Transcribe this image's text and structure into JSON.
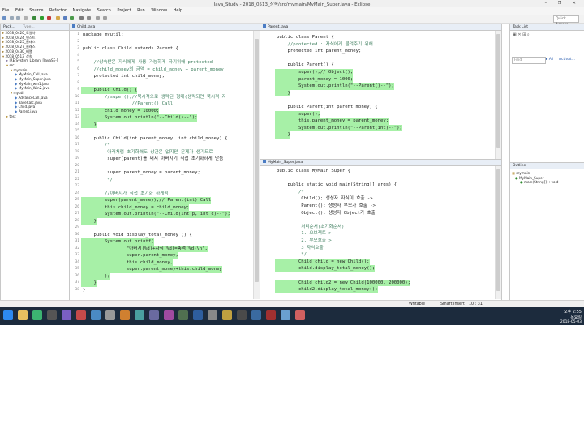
{
  "window": {
    "title": "Java_Study - 2018_0513_상속/src/mymain/MyMain_Super.java - Eclipse",
    "buttons": "– ❐ ✕"
  },
  "menu": [
    "File",
    "Edit",
    "Source",
    "Refactor",
    "Navigate",
    "Search",
    "Project",
    "Run",
    "Window",
    "Help"
  ],
  "quick_access": "Quick Access",
  "package_explorer": {
    "tab": "Pack...",
    "tab2": "Type...",
    "items": [
      "2018_0420_도일차",
      "2018_0424_연스트",
      "2018_0425_클래스",
      "2018_0427_클래스",
      "2018_0430_배열",
      "2018_0513_상속",
      "JRE System Library [JavaSE-]",
      "src",
      "mymain",
      "MyMain_Call.java",
      "MyMain_Super.java",
      "MyMain_win1.java",
      "MyMain_Win2.java",
      "myutil",
      "AdvanceCall.java",
      "BaseCalc.java",
      "Child.java",
      "Parent.java",
      "test"
    ]
  },
  "child_editor": {
    "tab": "Child.java",
    "lines": [
      [
        "1",
        "package myutil;",
        ""
      ],
      [
        "2",
        "",
        ""
      ],
      [
        "3",
        "public class Child extends Parent {",
        ""
      ],
      [
        "4",
        "",
        ""
      ],
      [
        "5",
        "    //상속받은 자식에게 사용 가능하게 하기위해 protected",
        ""
      ],
      [
        "6",
        "    //child_money의 금액 = child_money + parent_money",
        ""
      ],
      [
        "7",
        "    protected int child_money;",
        ""
      ],
      [
        "8",
        "",
        ""
      ],
      [
        "9",
        "    public Child() {",
        "hl"
      ],
      [
        "10",
        "        //super();//묵시적으로 생략된 형태(생략되면 묵시적 자",
        ""
      ],
      [
        "11",
        "                  //Parent() Call",
        ""
      ],
      [
        "12",
        "        child_money = 10000;",
        "hl"
      ],
      [
        "13",
        "        System.out.println(\"--Child()--\");",
        "hl"
      ],
      [
        "14",
        "    }",
        "hl"
      ],
      [
        "15",
        "",
        ""
      ],
      [
        "16",
        "    public Child(int parent_money, int child_money) {",
        ""
      ],
      [
        "17",
        "        /*",
        ""
      ],
      [
        "18",
        "         아래처럼 초기화해도 상관은 없지만 문제가 생기므로",
        ""
      ],
      [
        "19",
        "         super(parent)를 써서 아버지기 직접 초기화하게 만듬",
        ""
      ],
      [
        "20",
        "",
        ""
      ],
      [
        "21",
        "         super.parent_money = parent_money;",
        ""
      ],
      [
        "22",
        "         */",
        ""
      ],
      [
        "23",
        "",
        ""
      ],
      [
        "24",
        "        //아버지가 직접 초기화 하게됨",
        ""
      ],
      [
        "25",
        "        super(parent_money);// Parent(int) Call",
        "hl"
      ],
      [
        "26",
        "        this.child_money = child_money;",
        "hl"
      ],
      [
        "27",
        "        System.out.println(\"--Child(int p, int c)--\");",
        "hl"
      ],
      [
        "28",
        "    }",
        "hl"
      ],
      [
        "29",
        "",
        ""
      ],
      [
        "30",
        "    public void display_total_money () {",
        ""
      ],
      [
        "31",
        "        System.out.printf(",
        "hl"
      ],
      [
        "32",
        "                \"아버지(%d)+자식(%d)=총액(%d)\\n\",",
        "hl"
      ],
      [
        "33",
        "                super.parent_money,",
        "hl"
      ],
      [
        "34",
        "                this.child_money,",
        "hl"
      ],
      [
        "35",
        "                super.parent_money+this.child_money",
        "hl"
      ],
      [
        "36",
        "        );",
        "hl"
      ],
      [
        "37",
        "    }",
        "hl"
      ],
      [
        "38",
        "}",
        ""
      ]
    ]
  },
  "parent_editor": {
    "tab": "Parent.java",
    "lines": [
      [
        "",
        "public class Parent {",
        ""
      ],
      [
        "",
        "    //protected : 자식에게 물려주기 위해",
        ""
      ],
      [
        "",
        "    protected int parent_money;",
        ""
      ],
      [
        "",
        "",
        ""
      ],
      [
        "",
        "    public Parent() {",
        ""
      ],
      [
        "",
        "        super();// Object();",
        "hl"
      ],
      [
        "",
        "        parent_money = 1000;",
        "hl"
      ],
      [
        "",
        "        System.out.println(\"--Parent()--\");",
        "hl"
      ],
      [
        "",
        "    }",
        "hl"
      ],
      [
        "",
        "",
        ""
      ],
      [
        "",
        "    public Parent(int parent_money) {",
        ""
      ],
      [
        "",
        "        super();",
        "hl"
      ],
      [
        "",
        "        this.parent_money = parent_money;",
        "hl"
      ],
      [
        "",
        "        System.out.println(\"--Parent(int)--\");",
        "hl"
      ],
      [
        "",
        "    }",
        "hl"
      ]
    ]
  },
  "super_editor": {
    "tab": "MyMain_Super.java",
    "lines": [
      [
        "",
        "public class MyMain_Super {",
        ""
      ],
      [
        "",
        "",
        ""
      ],
      [
        "",
        "    public static void main(String[] args) {",
        ""
      ],
      [
        "",
        "        /*",
        ""
      ],
      [
        "",
        "         Child(); 생성자 자식이 호출 ->",
        ""
      ],
      [
        "",
        "         Parent(); 생성자 부모가 호출 ->",
        ""
      ],
      [
        "",
        "         Object(); 생성자 Object가 호출",
        ""
      ],
      [
        "",
        "",
        ""
      ],
      [
        "",
        "         처리순서(초기화순서)",
        ""
      ],
      [
        "",
        "         1. 오브젝트 >",
        ""
      ],
      [
        "",
        "         2. 부모호출 >",
        ""
      ],
      [
        "",
        "         3 자식호출",
        ""
      ],
      [
        "",
        "         */",
        ""
      ],
      [
        "",
        "        Child child = new Child();",
        "hl"
      ],
      [
        "",
        "        child.display_total_money();",
        "hl"
      ],
      [
        "",
        "",
        ""
      ],
      [
        "",
        "        Child child2 = new Child(100000, 200000);",
        "hl"
      ],
      [
        "",
        "        child2.display_total_money();",
        "hl"
      ]
    ]
  },
  "task_list": {
    "tab": "Task List",
    "find": "Find",
    "all": "All",
    "activate": "Activat..."
  },
  "outline": {
    "tab": "Outline",
    "items": [
      "mymain",
      "MyMain_Super",
      "main(String[]) : void"
    ]
  },
  "status": {
    "writable": "Writable",
    "insert": "Smart Insert",
    "position": "10 : 31"
  },
  "taskbar": {
    "time": "오후 2:55",
    "day": "목요일",
    "date": "2018-05-03"
  }
}
